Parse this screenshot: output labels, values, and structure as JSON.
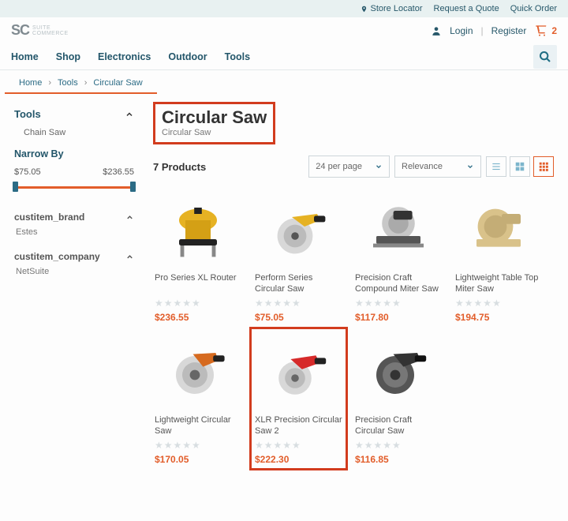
{
  "topbar": {
    "store_locator": "Store Locator",
    "request_quote": "Request a Quote",
    "quick_order": "Quick Order"
  },
  "logo": {
    "main": "SC",
    "line1": "SUITE",
    "line2": "COMMERCE"
  },
  "user": {
    "login": "Login",
    "register": "Register",
    "cart_count": "2"
  },
  "nav": {
    "home": "Home",
    "shop": "Shop",
    "electronics": "Electronics",
    "outdoor": "Outdoor",
    "tools": "Tools"
  },
  "breadcrumb": {
    "a": "Home",
    "b": "Tools",
    "c": "Circular Saw"
  },
  "sidebar": {
    "tools_label": "Tools",
    "chain_saw": "Chain Saw",
    "narrow_by": "Narrow By",
    "price_min": "$75.05",
    "price_max": "$236.55",
    "facet_brand": "custitem_brand",
    "brand_val": "Estes",
    "facet_company": "custitem_company",
    "company_val": "NetSuite"
  },
  "page": {
    "title": "Circular Saw",
    "subtitle": "Circular Saw",
    "count": "7 Products",
    "per_page": "24 per page",
    "sort": "Relevance"
  },
  "products": [
    {
      "name": "Pro Series XL Router",
      "price": "$236.55"
    },
    {
      "name": "Perform Series Circular Saw",
      "price": "$75.05"
    },
    {
      "name": "Precision Craft Compound Miter Saw",
      "price": "$117.80"
    },
    {
      "name": "Lightweight Table Top Miter Saw",
      "price": "$194.75"
    },
    {
      "name": "Lightweight Circular Saw",
      "price": "$170.05"
    },
    {
      "name": "XLR Precision Circular Saw 2",
      "price": "$222.30"
    },
    {
      "name": "Precision Craft Circular Saw",
      "price": "$116.85"
    }
  ],
  "colors": {
    "accent": "#e25d2a",
    "highlight": "#d23c1e",
    "teal": "#23566a"
  }
}
